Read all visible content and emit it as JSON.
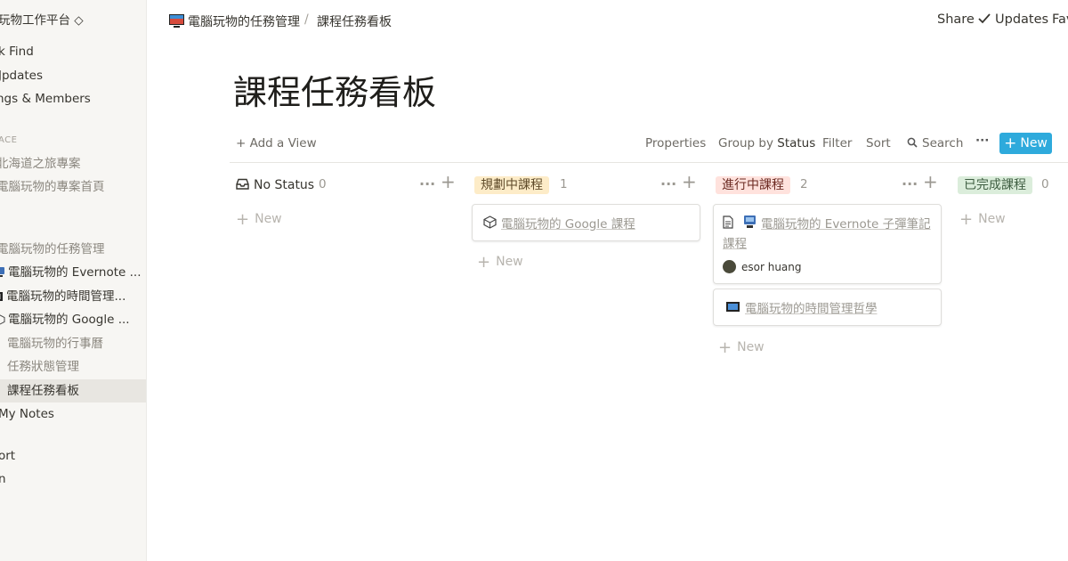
{
  "sidebar": {
    "workspace": "玩物工作平台 ◇",
    "top_items": [
      "k Find",
      "Jpdates",
      "ngs & Members"
    ],
    "section_header": "ACE",
    "workspace_pages": [
      "北海道之旅專案",
      "電腦玩物的專案首頁"
    ],
    "tree": [
      {
        "label": "電腦玩物的任務管理",
        "icon": "none"
      },
      {
        "label": "電腦玩物的 Evernote ...",
        "icon": "monitor-icon"
      },
      {
        "label": "電腦玩物的時間管理...",
        "icon": "film-icon"
      },
      {
        "label": "電腦玩物的 Google ...",
        "icon": "cube-icon"
      },
      {
        "label": "電腦玩物的行事曆",
        "icon": "none"
      },
      {
        "label": "任務狀態管理",
        "icon": "none"
      },
      {
        "label": "課程任務看板",
        "icon": "none",
        "active": true
      }
    ],
    "my_notes": "My Notes",
    "bottom_items": [
      "ort",
      "n"
    ]
  },
  "topbar": {
    "breadcrumb_parent": "電腦玩物的任務管理",
    "breadcrumb_separator": "/",
    "breadcrumb_current": "課程任務看板",
    "share": "Share",
    "updates": "Updates",
    "favorite": "Fav"
  },
  "page": {
    "title": "課程任務看板"
  },
  "toolbar": {
    "add_view": "+ Add a View",
    "properties": "Properties",
    "group_by": "Group by",
    "group_by_value": "Status",
    "filter": "Filter",
    "sort": "Sort",
    "search": "Search",
    "more": "···",
    "new": "New"
  },
  "board": {
    "new_label": "New",
    "columns": [
      {
        "name": "No Status",
        "count": "0",
        "color": "#ffffff",
        "text_color": "#37352f",
        "cards": []
      },
      {
        "name": "規劃中課程",
        "count": "1",
        "color": "#fdecc8",
        "text_color": "#5f4b2a",
        "cards": [
          {
            "title": "電腦玩物的 Google 課程",
            "icon": "cube-icon"
          }
        ]
      },
      {
        "name": "進行中課程",
        "count": "2",
        "color": "#ffe2dd",
        "text_color": "#6b2a22",
        "cards": [
          {
            "title_line1": "電腦玩物的 Evernote 子彈筆記",
            "title_line2": "課程",
            "icon": "monitor-icon",
            "doc_icon": "page-icon",
            "person": "esor huang"
          },
          {
            "title": "電腦玩物的時間管理哲學",
            "icon": "film-icon"
          }
        ]
      },
      {
        "name": "已完成課程",
        "count": "0",
        "color": "#dbeddb",
        "text_color": "#3f5e42",
        "cards": []
      }
    ]
  },
  "colors": {
    "accent": "#2eaadc",
    "sidebar_bg": "#f7f6f3"
  }
}
